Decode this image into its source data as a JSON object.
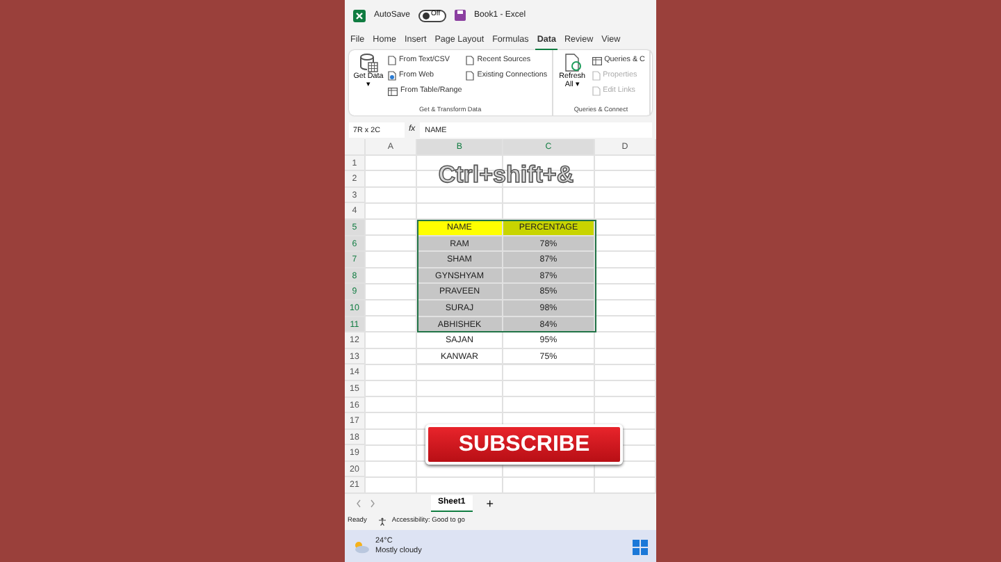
{
  "window": {
    "autosave_label": "AutoSave",
    "autosave_toggle": {
      "label": "Off",
      "on": false
    },
    "title": "Book1 - Excel"
  },
  "tabs": [
    {
      "label": "File",
      "selected": false
    },
    {
      "label": "Home",
      "selected": false
    },
    {
      "label": "Insert",
      "selected": false
    },
    {
      "label": "Page Layout",
      "selected": false
    },
    {
      "label": "Formulas",
      "selected": false
    },
    {
      "label": "Data",
      "selected": true
    },
    {
      "label": "Review",
      "selected": false
    },
    {
      "label": "View",
      "selected": false
    }
  ],
  "ribbon": {
    "groups": [
      {
        "title": "Get & Transform Data",
        "big_button": {
          "label": "Get Data ▾",
          "kind": "database"
        },
        "columns": [
          [
            {
              "label": "From Text/CSV",
              "disabled": false,
              "kind": "file"
            },
            {
              "label": "From Web",
              "disabled": false,
              "kind": "web"
            },
            {
              "label": "From Table/Range",
              "disabled": false,
              "kind": "table"
            }
          ],
          [
            {
              "label": "Recent Sources",
              "disabled": false,
              "kind": "file"
            },
            {
              "label": "Existing Connections",
              "disabled": false,
              "kind": "file"
            }
          ]
        ]
      },
      {
        "title": "Queries & Connect",
        "big_button": {
          "label": "Refresh All ▾",
          "kind": "refresh"
        },
        "columns": [
          [
            {
              "label": "Queries & C",
              "disabled": false,
              "kind": "table"
            },
            {
              "label": "Properties",
              "disabled": true,
              "kind": "file"
            },
            {
              "label": "Edit Links",
              "disabled": true,
              "kind": "file"
            }
          ]
        ]
      }
    ]
  },
  "formula_bar": {
    "name_box": "7R x 2C",
    "fx": "fx",
    "value": "NAME"
  },
  "sheet": {
    "columns": [
      "A",
      "B",
      "C",
      "D"
    ],
    "row_numbers": [
      "1",
      "2",
      "3",
      "4",
      "5",
      "6",
      "7",
      "8",
      "9",
      "10",
      "11",
      "12",
      "13",
      "14",
      "15",
      "16",
      "17",
      "18",
      "19",
      "20",
      "21"
    ],
    "heading": "Ctrl+shift+&",
    "table_header": {
      "cells": [
        "NAME",
        "PERCENTAGE"
      ],
      "selected": true
    },
    "table_rows": [
      {
        "name": "RAM",
        "percentage": "78%",
        "selected": true
      },
      {
        "name": "SHAM",
        "percentage": "87%",
        "selected": true
      },
      {
        "name": "GYNSHYAM",
        "percentage": "87%",
        "selected": true
      },
      {
        "name": "PRAVEEN",
        "percentage": "85%",
        "selected": true
      },
      {
        "name": "SURAJ",
        "percentage": "98%",
        "selected": true
      },
      {
        "name": "ABHISHEK",
        "percentage": "84%",
        "selected": true
      },
      {
        "name": "SAJAN",
        "percentage": "95%",
        "selected": false
      },
      {
        "name": "KANWAR",
        "percentage": "75%",
        "selected": false
      }
    ],
    "overlay_button": "SUBSCRIBE"
  },
  "sheet_tabs": [
    {
      "label": "Sheet1",
      "selected": true
    }
  ],
  "add_sheet": "+",
  "status_bar": {
    "state": "Ready",
    "accessibility": "Accessibility: Good to go"
  },
  "taskbar": {
    "temperature": "24°C",
    "weather": "Mostly cloudy"
  }
}
